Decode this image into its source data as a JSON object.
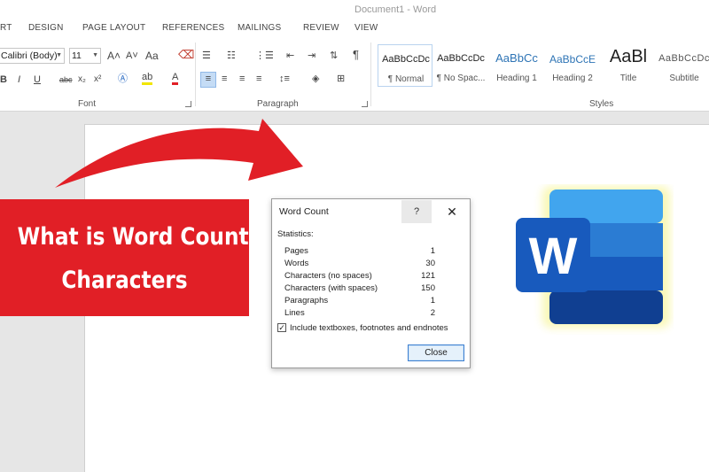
{
  "window": {
    "title": "Document1 - Word"
  },
  "ribbon_tabs": [
    "RT",
    "DESIGN",
    "PAGE LAYOUT",
    "REFERENCES",
    "MAILINGS",
    "REVIEW",
    "VIEW"
  ],
  "font_group": {
    "label": "Font",
    "font_name": "Calibri (Body)",
    "font_size": "11",
    "grow_icon": "A˄",
    "shrink_icon": "A˅",
    "case_icon": "Aa",
    "bold": "B",
    "italic": "I",
    "underline": "U",
    "strike": "abc",
    "subscript": "x₂",
    "superscript": "x²",
    "font_color": "A"
  },
  "paragraph_group": {
    "label": "Paragraph",
    "pilcrow": "¶"
  },
  "styles_group": {
    "label": "Styles",
    "items": [
      {
        "preview": "AaBbCcDc",
        "name": "¶ Normal"
      },
      {
        "preview": "AaBbCcDc",
        "name": "¶ No Spac..."
      },
      {
        "preview": "AaBbCc",
        "name": "Heading 1"
      },
      {
        "preview": "AaBbCcE",
        "name": "Heading 2"
      },
      {
        "preview": "AaBl",
        "name": "Title"
      },
      {
        "preview": "AaBbCcDc",
        "name": "Subtitle"
      }
    ]
  },
  "banner": {
    "line1": "What is Word Count",
    "line2": "Characters",
    "color": "#e11f26"
  },
  "dialog": {
    "title": "Word Count",
    "help": "?",
    "close_x": "✕",
    "statistics_label": "Statistics:",
    "stats": [
      {
        "label": "Pages",
        "value": "1"
      },
      {
        "label": "Words",
        "value": "30"
      },
      {
        "label": "Characters (no spaces)",
        "value": "121"
      },
      {
        "label": "Characters (with spaces)",
        "value": "150"
      },
      {
        "label": "Paragraphs",
        "value": "1"
      },
      {
        "label": "Lines",
        "value": "2"
      }
    ],
    "include_checked": true,
    "include_label": "Include textboxes, footnotes and endnotes",
    "close_button": "Close"
  },
  "logo": {
    "letter": "W"
  },
  "colors": {
    "accent_red": "#e11f26",
    "word_blue_dark": "#185abd",
    "word_blue_light": "#41a5ee"
  }
}
